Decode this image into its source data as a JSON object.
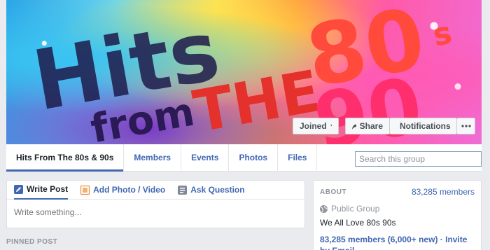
{
  "cover": {
    "art_text": {
      "hits": "Hits",
      "from": "from",
      "the": "THE",
      "eighties": "80",
      "s": "s",
      "nineties": "90"
    },
    "buttons": {
      "joined": "Joined",
      "share": "Share",
      "notifications": "Notifications"
    }
  },
  "nav": {
    "title": "Hits From The 80s & 90s",
    "items": [
      "Members",
      "Events",
      "Photos",
      "Files"
    ],
    "search_placeholder": "Search this group"
  },
  "composer": {
    "tabs": {
      "write_post": "Write Post",
      "add_photo": "Add Photo / Video",
      "ask_question": "Ask Question"
    },
    "placeholder": "Write something..."
  },
  "pinned_label": "PINNED POST",
  "about": {
    "title": "ABOUT",
    "member_count": "83,285 members",
    "group_type": "Public Group",
    "description": "We All Love 80s 90s",
    "members_link": "83,285 members (6,000+ new)",
    "separator": " · ",
    "invite_link": "Invite by Email"
  },
  "colors": {
    "accent": "#4267b2",
    "background": "#e9ebee"
  }
}
